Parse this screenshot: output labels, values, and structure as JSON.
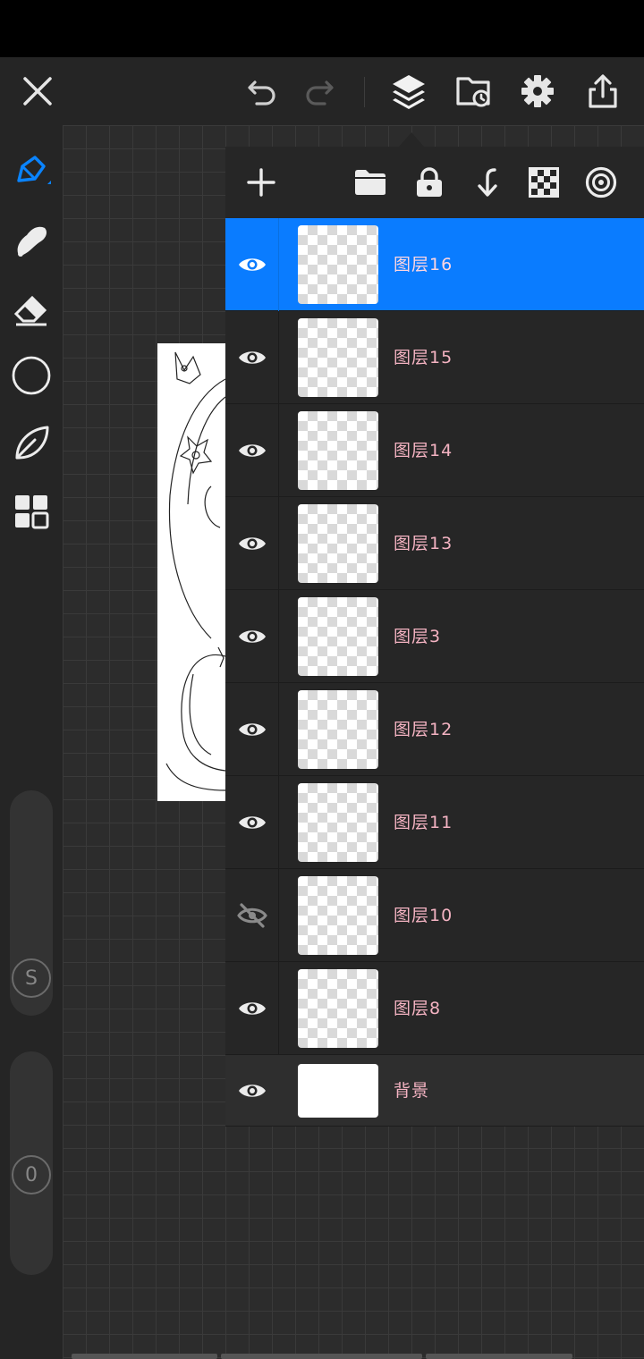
{
  "window": {
    "title": ""
  },
  "toolbar": {
    "close": "close-icon",
    "undo": "undo-icon",
    "redo": "redo-icon",
    "layers": "layers-icon",
    "gallery": "gallery-icon",
    "settings": "gear-icon",
    "share": "share-icon"
  },
  "tools": [
    "brush",
    "smudge",
    "eraser",
    "shape",
    "lasso",
    "grid"
  ],
  "sliders": {
    "top_label": "S",
    "bottom_label": "0"
  },
  "layer_panel": {
    "actions": [
      "add",
      "folder",
      "lock",
      "merge-down",
      "transparency",
      "reference"
    ],
    "layers": [
      {
        "name": "图层16",
        "visible": true,
        "selected": true
      },
      {
        "name": "图层15",
        "visible": true,
        "selected": false
      },
      {
        "name": "图层14",
        "visible": true,
        "selected": false
      },
      {
        "name": "图层13",
        "visible": true,
        "selected": false
      },
      {
        "name": "图层3",
        "visible": true,
        "selected": false
      },
      {
        "name": "图层12",
        "visible": true,
        "selected": false
      },
      {
        "name": "图层11",
        "visible": true,
        "selected": false
      },
      {
        "name": "图层10",
        "visible": false,
        "selected": false
      },
      {
        "name": "图层8",
        "visible": true,
        "selected": false
      },
      {
        "name": "背景",
        "visible": true,
        "selected": false
      }
    ]
  },
  "colors": {
    "accent": "#0a7cff",
    "layer_text": "#f4b3c2"
  }
}
